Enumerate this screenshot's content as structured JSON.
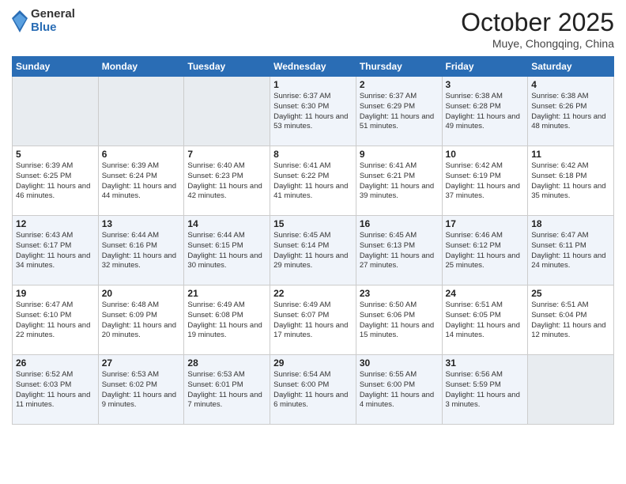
{
  "header": {
    "logo_general": "General",
    "logo_blue": "Blue",
    "month": "October 2025",
    "location": "Muye, Chongqing, China"
  },
  "weekdays": [
    "Sunday",
    "Monday",
    "Tuesday",
    "Wednesday",
    "Thursday",
    "Friday",
    "Saturday"
  ],
  "weeks": [
    [
      {
        "day": "",
        "info": ""
      },
      {
        "day": "",
        "info": ""
      },
      {
        "day": "",
        "info": ""
      },
      {
        "day": "1",
        "info": "Sunrise: 6:37 AM\nSunset: 6:30 PM\nDaylight: 11 hours and 53 minutes."
      },
      {
        "day": "2",
        "info": "Sunrise: 6:37 AM\nSunset: 6:29 PM\nDaylight: 11 hours and 51 minutes."
      },
      {
        "day": "3",
        "info": "Sunrise: 6:38 AM\nSunset: 6:28 PM\nDaylight: 11 hours and 49 minutes."
      },
      {
        "day": "4",
        "info": "Sunrise: 6:38 AM\nSunset: 6:26 PM\nDaylight: 11 hours and 48 minutes."
      }
    ],
    [
      {
        "day": "5",
        "info": "Sunrise: 6:39 AM\nSunset: 6:25 PM\nDaylight: 11 hours and 46 minutes."
      },
      {
        "day": "6",
        "info": "Sunrise: 6:39 AM\nSunset: 6:24 PM\nDaylight: 11 hours and 44 minutes."
      },
      {
        "day": "7",
        "info": "Sunrise: 6:40 AM\nSunset: 6:23 PM\nDaylight: 11 hours and 42 minutes."
      },
      {
        "day": "8",
        "info": "Sunrise: 6:41 AM\nSunset: 6:22 PM\nDaylight: 11 hours and 41 minutes."
      },
      {
        "day": "9",
        "info": "Sunrise: 6:41 AM\nSunset: 6:21 PM\nDaylight: 11 hours and 39 minutes."
      },
      {
        "day": "10",
        "info": "Sunrise: 6:42 AM\nSunset: 6:19 PM\nDaylight: 11 hours and 37 minutes."
      },
      {
        "day": "11",
        "info": "Sunrise: 6:42 AM\nSunset: 6:18 PM\nDaylight: 11 hours and 35 minutes."
      }
    ],
    [
      {
        "day": "12",
        "info": "Sunrise: 6:43 AM\nSunset: 6:17 PM\nDaylight: 11 hours and 34 minutes."
      },
      {
        "day": "13",
        "info": "Sunrise: 6:44 AM\nSunset: 6:16 PM\nDaylight: 11 hours and 32 minutes."
      },
      {
        "day": "14",
        "info": "Sunrise: 6:44 AM\nSunset: 6:15 PM\nDaylight: 11 hours and 30 minutes."
      },
      {
        "day": "15",
        "info": "Sunrise: 6:45 AM\nSunset: 6:14 PM\nDaylight: 11 hours and 29 minutes."
      },
      {
        "day": "16",
        "info": "Sunrise: 6:45 AM\nSunset: 6:13 PM\nDaylight: 11 hours and 27 minutes."
      },
      {
        "day": "17",
        "info": "Sunrise: 6:46 AM\nSunset: 6:12 PM\nDaylight: 11 hours and 25 minutes."
      },
      {
        "day": "18",
        "info": "Sunrise: 6:47 AM\nSunset: 6:11 PM\nDaylight: 11 hours and 24 minutes."
      }
    ],
    [
      {
        "day": "19",
        "info": "Sunrise: 6:47 AM\nSunset: 6:10 PM\nDaylight: 11 hours and 22 minutes."
      },
      {
        "day": "20",
        "info": "Sunrise: 6:48 AM\nSunset: 6:09 PM\nDaylight: 11 hours and 20 minutes."
      },
      {
        "day": "21",
        "info": "Sunrise: 6:49 AM\nSunset: 6:08 PM\nDaylight: 11 hours and 19 minutes."
      },
      {
        "day": "22",
        "info": "Sunrise: 6:49 AM\nSunset: 6:07 PM\nDaylight: 11 hours and 17 minutes."
      },
      {
        "day": "23",
        "info": "Sunrise: 6:50 AM\nSunset: 6:06 PM\nDaylight: 11 hours and 15 minutes."
      },
      {
        "day": "24",
        "info": "Sunrise: 6:51 AM\nSunset: 6:05 PM\nDaylight: 11 hours and 14 minutes."
      },
      {
        "day": "25",
        "info": "Sunrise: 6:51 AM\nSunset: 6:04 PM\nDaylight: 11 hours and 12 minutes."
      }
    ],
    [
      {
        "day": "26",
        "info": "Sunrise: 6:52 AM\nSunset: 6:03 PM\nDaylight: 11 hours and 11 minutes."
      },
      {
        "day": "27",
        "info": "Sunrise: 6:53 AM\nSunset: 6:02 PM\nDaylight: 11 hours and 9 minutes."
      },
      {
        "day": "28",
        "info": "Sunrise: 6:53 AM\nSunset: 6:01 PM\nDaylight: 11 hours and 7 minutes."
      },
      {
        "day": "29",
        "info": "Sunrise: 6:54 AM\nSunset: 6:00 PM\nDaylight: 11 hours and 6 minutes."
      },
      {
        "day": "30",
        "info": "Sunrise: 6:55 AM\nSunset: 6:00 PM\nDaylight: 11 hours and 4 minutes."
      },
      {
        "day": "31",
        "info": "Sunrise: 6:56 AM\nSunset: 5:59 PM\nDaylight: 11 hours and 3 minutes."
      },
      {
        "day": "",
        "info": ""
      }
    ]
  ]
}
